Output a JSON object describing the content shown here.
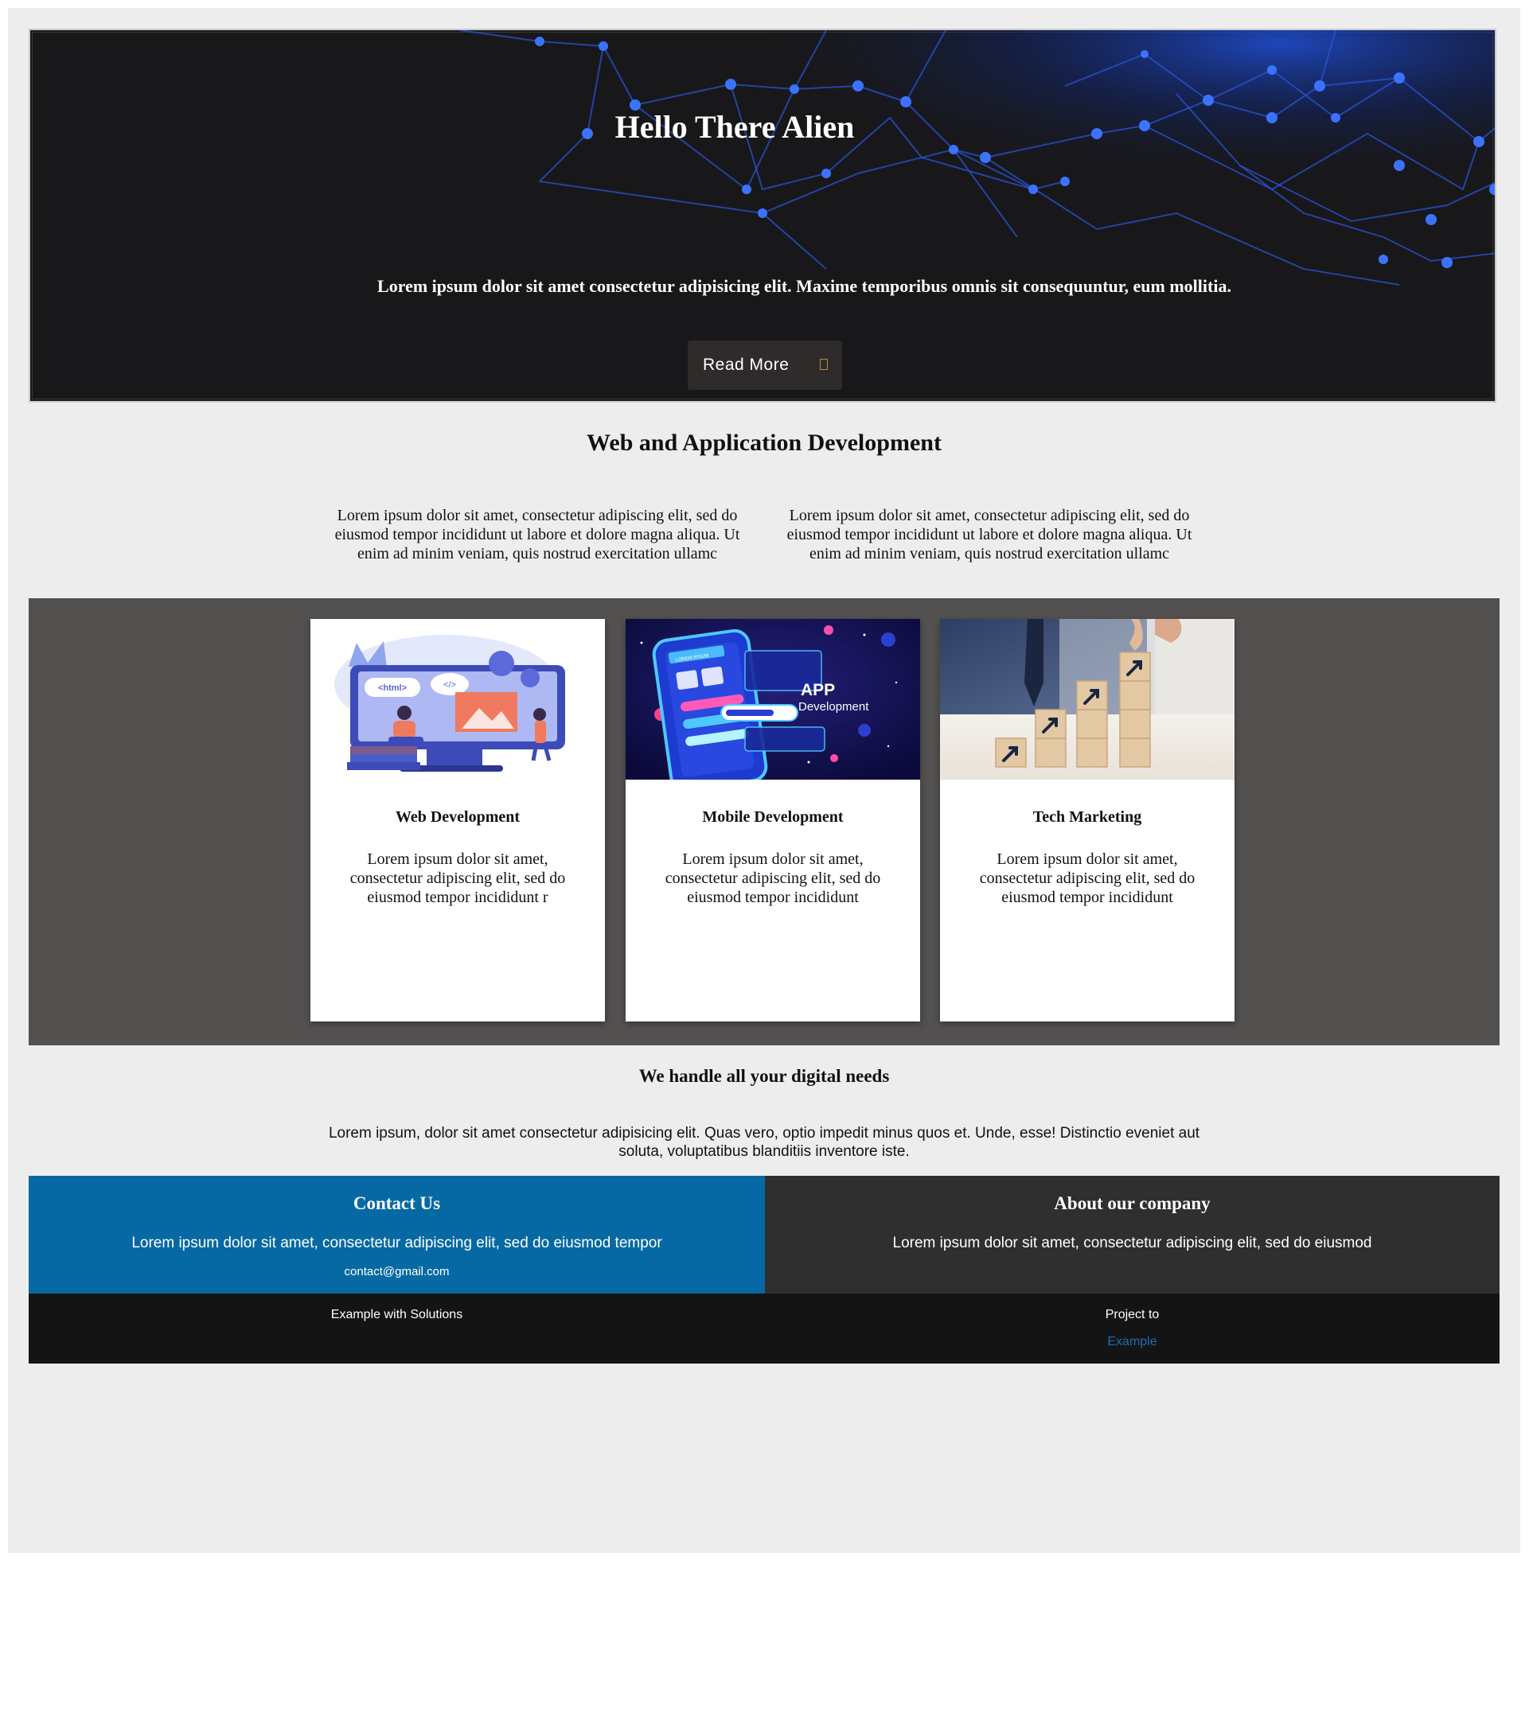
{
  "hero": {
    "title": "Hello There Alien",
    "subtitle": "Lorem ipsum dolor sit amet consectetur adipisicing elit. Maxime temporibus omnis sit consequuntur, eum mollitia.",
    "button_label": "Read More",
    "button_icon": "arrow-icon"
  },
  "section": {
    "title": "Web and Application Development",
    "columns": [
      "Lorem ipsum dolor sit amet, consectetur adipiscing elit, sed do eiusmod tempor incididunt ut labore et dolore magna aliqua. Ut enim ad minim veniam, quis nostrud exercitation ullamc",
      "Lorem ipsum dolor sit amet, consectetur adipiscing elit, sed do eiusmod tempor incididunt ut labore et dolore magna aliqua. Ut enim ad minim veniam, quis nostrud exercitation ullamc"
    ]
  },
  "cards": [
    {
      "title": "Web Development",
      "text": "Lorem ipsum dolor sit amet, consectetur adipiscing elit, sed do eiusmod tempor incididunt r",
      "image_label": "<html>"
    },
    {
      "title": "Mobile Development",
      "text": "Lorem ipsum dolor sit amet, consectetur adipiscing elit, sed do eiusmod tempor incididunt",
      "image_label": "APP",
      "image_sublabel": "Development",
      "image_screen_label": "LOREM IPSUM"
    },
    {
      "title": "Tech Marketing",
      "text": "Lorem ipsum dolor sit amet, consectetur adipiscing elit, sed do eiusmod tempor incididunt"
    }
  ],
  "needs": {
    "title": "We handle all your digital needs",
    "text": "Lorem ipsum, dolor sit amet consectetur adipisicing elit. Quas vero, optio impedit minus quos et. Unde, esse! Distinctio eveniet aut soluta, voluptatibus blanditiis inventore iste."
  },
  "contact": {
    "title": "Contact Us",
    "text": "Lorem ipsum dolor sit amet, consectetur adipiscing elit, sed do eiusmod tempor",
    "email": "contact@gmail.com"
  },
  "about": {
    "title": "About our company",
    "text": "Lorem ipsum dolor sit amet, consectetur adipiscing elit, sed do eiusmod"
  },
  "footer": {
    "left": "Example with Solutions",
    "right": "Project to",
    "link": "Example"
  },
  "colors": {
    "page_bg": "#ededed",
    "hero_bg": "#18181a",
    "band_bg": "#535150",
    "contact_bg": "#0769a3",
    "about_bg": "#2f2f2f",
    "footer_bg": "#141414",
    "link": "#1a6db3"
  }
}
